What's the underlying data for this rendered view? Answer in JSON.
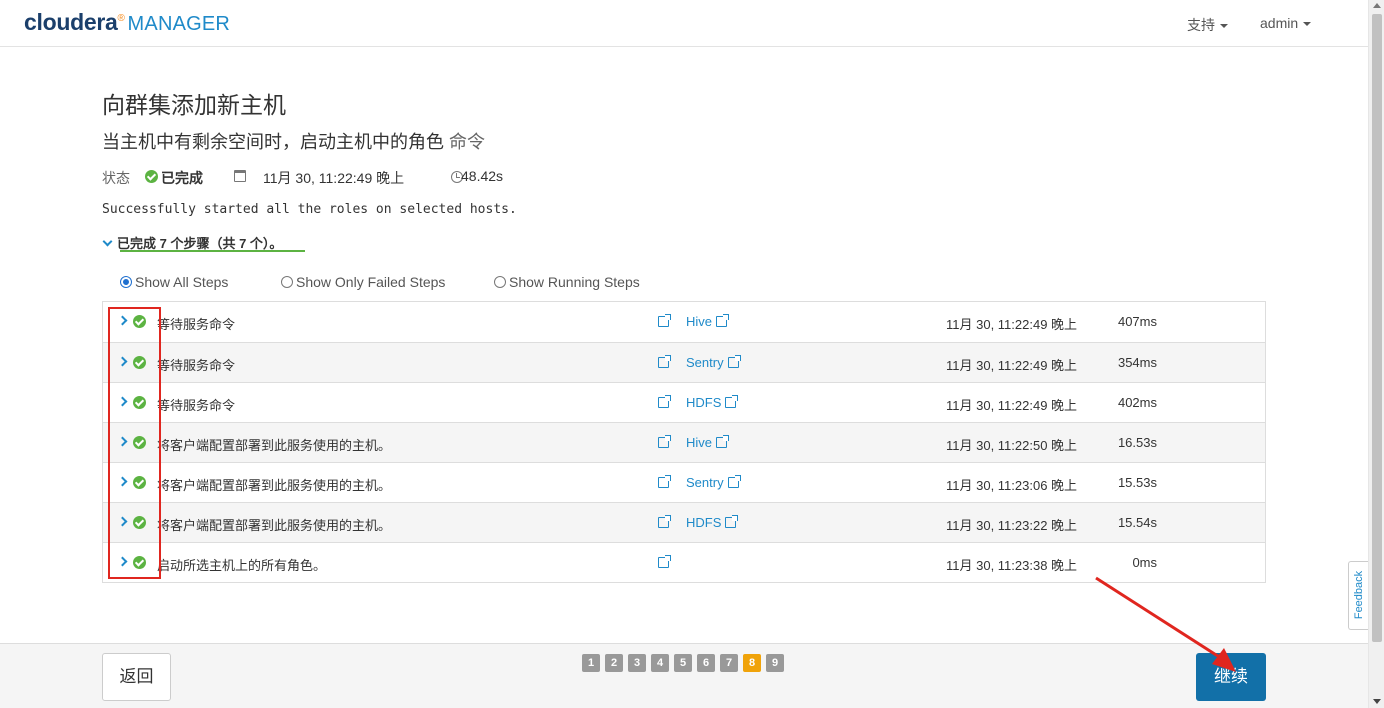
{
  "header": {
    "logo_brand": "cloudera",
    "logo_mark": "®",
    "logo_product": "MANAGER",
    "nav_support": "支持",
    "nav_user": "admin"
  },
  "page_title": "向群集添加新主机",
  "command": {
    "title": "当主机中有剩余空间时，启动主机中的角色",
    "title_suffix": "命令",
    "status_label": "状态",
    "status_value": "已完成",
    "start_time": "11月 30, 11:22:49 晚上",
    "duration": "48.42s",
    "result_message": "Successfully started all the roles on selected hosts.",
    "steps_summary": "已完成 7 个步骤（共 7 个）。"
  },
  "filters": {
    "options": [
      "Show All Steps",
      "Show Only Failed Steps",
      "Show Running Steps"
    ],
    "selected": "Show All Steps"
  },
  "steps": [
    {
      "description": "等待服务命令",
      "service": "Hive",
      "time": "11月 30, 11:22:49 晚上",
      "duration": "407ms"
    },
    {
      "description": "等待服务命令",
      "service": "Sentry",
      "time": "11月 30, 11:22:49 晚上",
      "duration": "354ms"
    },
    {
      "description": "等待服务命令",
      "service": "HDFS",
      "time": "11月 30, 11:22:49 晚上",
      "duration": "402ms"
    },
    {
      "description": "将客户端配置部署到此服务使用的主机。",
      "service": "Hive",
      "time": "11月 30, 11:22:50 晚上",
      "duration": "16.53s"
    },
    {
      "description": "将客户端配置部署到此服务使用的主机。",
      "service": "Sentry",
      "time": "11月 30, 11:23:06 晚上",
      "duration": "15.53s"
    },
    {
      "description": "将客户端配置部署到此服务使用的主机。",
      "service": "HDFS",
      "time": "11月 30, 11:23:22 晚上",
      "duration": "15.54s"
    },
    {
      "description": "启动所选主机上的所有角色。",
      "service": "",
      "time": "11月 30, 11:23:38 晚上",
      "duration": "0ms"
    }
  ],
  "footer": {
    "back_label": "返回",
    "continue_label": "继续",
    "pages": [
      "1",
      "2",
      "3",
      "4",
      "5",
      "6",
      "7",
      "8",
      "9"
    ],
    "current_page": "8"
  },
  "feedback_label": "Feedback",
  "colors": {
    "accent": "#1f8ac9",
    "success": "#5cb342",
    "primary_button": "#1270a8",
    "active_page": "#f0a30a",
    "annotation_red": "#e0261f"
  }
}
